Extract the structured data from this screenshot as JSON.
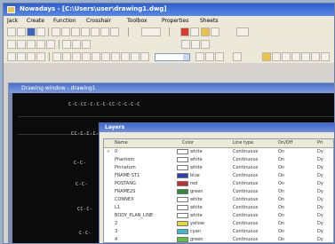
{
  "window": {
    "title": "Nowadays - [C:\\Users\\user\\drawing1.dwg]"
  },
  "menubar": {
    "items": [
      "Jack",
      "Create",
      "Function",
      "Crosshair",
      "Toolbox",
      "Properties",
      "Sheets"
    ]
  },
  "drawing": {
    "title": "Drawing window - drawing1"
  },
  "canvas": {
    "chips": [
      "C-C-CC-C-C-C-CC-C-C-C-C",
      "CC-C-C-C-",
      "C-C-",
      "C-C-",
      "CC-C-",
      "C-C-"
    ]
  },
  "dialog": {
    "title": "Layers",
    "columns": [
      "Name",
      "Color",
      "Line type",
      "On/Off",
      "Pri"
    ],
    "rows": [
      {
        "check": "✓",
        "name": "0",
        "color_name": "white",
        "swatch": "#ffffff",
        "linetype": "Continuous",
        "onoff": "On",
        "pri": "Dy"
      },
      {
        "check": "",
        "name": "Phantom",
        "color_name": "white",
        "swatch": "#ffffff",
        "linetype": "Continuous",
        "onoff": "On",
        "pri": "Dy"
      },
      {
        "check": "",
        "name": "Pinnatum",
        "color_name": "white",
        "swatch": "#ffffff",
        "linetype": "Continuous",
        "onoff": "On",
        "pri": "Dy"
      },
      {
        "check": "",
        "name": "FRAME-ST1",
        "color_name": "blue",
        "swatch": "#2d3fb5",
        "linetype": "Continuous",
        "onoff": "On",
        "pri": "Dy"
      },
      {
        "check": "",
        "name": "POSTANG",
        "color_name": "red",
        "swatch": "#cc2a2a",
        "linetype": "Continuous",
        "onoff": "On",
        "pri": "Dy"
      },
      {
        "check": "",
        "name": "FRAME2S",
        "color_name": "green",
        "swatch": "#2f8a3a",
        "linetype": "Continuous",
        "onoff": "On",
        "pri": "Dy"
      },
      {
        "check": "",
        "name": "CONNEX",
        "color_name": "white",
        "swatch": "#ffffff",
        "linetype": "Continuous",
        "onoff": "On",
        "pri": "Dy"
      },
      {
        "check": "",
        "name": "L1",
        "color_name": "white",
        "swatch": "#ffffff",
        "linetype": "Continuous",
        "onoff": "On",
        "pri": "Dy"
      },
      {
        "check": "",
        "name": "BODY_PLAN_LINE",
        "color_name": "white",
        "swatch": "#ffffff",
        "linetype": "Continuous",
        "onoff": "On",
        "pri": "Dy"
      },
      {
        "check": "",
        "name": "2",
        "color_name": "yellow",
        "swatch": "#e5d53a",
        "linetype": "Continuous",
        "onoff": "On",
        "pri": "Dy"
      },
      {
        "check": "",
        "name": "3",
        "color_name": "cyan",
        "swatch": "#3ab8d8",
        "linetype": "Continuous",
        "onoff": "On",
        "pri": "Dy"
      },
      {
        "check": "",
        "name": "4",
        "color_name": "green",
        "swatch": "#5cc43a",
        "linetype": "Continuous",
        "onoff": "On",
        "pri": "Dy"
      }
    ]
  }
}
